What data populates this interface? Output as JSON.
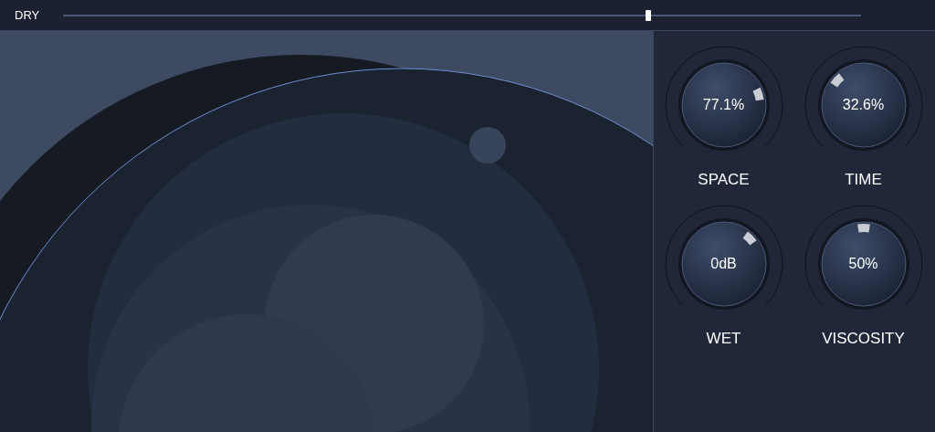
{
  "dry_slider": {
    "label": "DRY",
    "level": 0.733
  },
  "knobs": [
    {
      "label": "SPACE",
      "reading": "77.1%",
      "level": 0.771
    },
    {
      "label": "TIME",
      "reading": "32.6%",
      "level": 0.326
    },
    {
      "label": "WET",
      "reading": "0dB",
      "level": 0.667
    },
    {
      "label": "VISCOSITY",
      "reading": "50%",
      "level": 0.5
    }
  ]
}
